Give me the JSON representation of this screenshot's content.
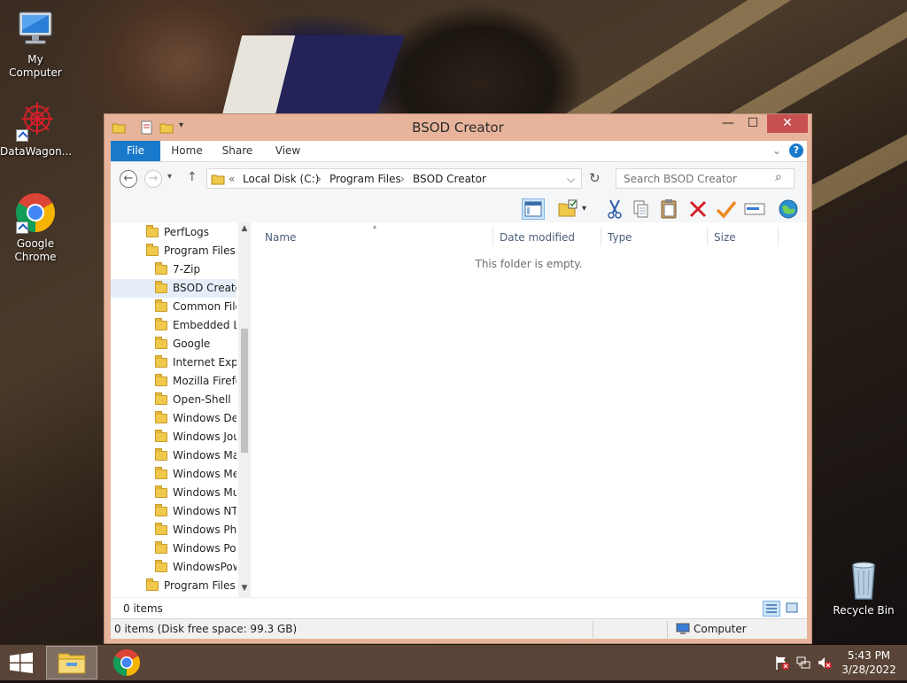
{
  "desktop": {
    "icons": [
      {
        "label": "My Computer"
      },
      {
        "label": "DataWagon..."
      },
      {
        "label": "Google Chrome"
      },
      {
        "label": "Recycle Bin"
      }
    ]
  },
  "window": {
    "title": "BSOD Creator",
    "controls": {
      "minimize": "—",
      "maximize": "☐",
      "close": "✕"
    },
    "ribbon": {
      "tabs": [
        "File",
        "Home",
        "Share",
        "View"
      ],
      "help": "?"
    },
    "nav": {
      "back": "←",
      "forward": "→",
      "recent": "▾",
      "up": "↑",
      "overflow": "«",
      "breadcrumb": [
        "Local Disk (C:)",
        "Program Files",
        "BSOD Creator"
      ],
      "separator": "›",
      "dropdown": "⌵",
      "refresh": "↻",
      "search_placeholder": "Search BSOD Creator",
      "search_icon": "⌕"
    },
    "toolbar_icons": [
      "preview-pane-icon",
      "properties-icon",
      "cut-icon",
      "copy-icon",
      "paste-icon",
      "delete-icon",
      "checkmark-icon",
      "rename-icon",
      "internet-icon"
    ],
    "tree": [
      {
        "label": "PerfLogs",
        "level": 1
      },
      {
        "label": "Program Files",
        "level": 1
      },
      {
        "label": "7-Zip",
        "level": 2
      },
      {
        "label": "BSOD Creato",
        "level": 2,
        "selected": true
      },
      {
        "label": "Common File",
        "level": 2
      },
      {
        "label": "Embedded Lo",
        "level": 2
      },
      {
        "label": "Google",
        "level": 2
      },
      {
        "label": "Internet Explo",
        "level": 2
      },
      {
        "label": "Mozilla Firefo",
        "level": 2
      },
      {
        "label": "Open-Shell",
        "level": 2
      },
      {
        "label": "Windows Def",
        "level": 2
      },
      {
        "label": "Windows Jou",
        "level": 2
      },
      {
        "label": "Windows Ma",
        "level": 2
      },
      {
        "label": "Windows Me",
        "level": 2
      },
      {
        "label": "Windows Mu",
        "level": 2
      },
      {
        "label": "Windows NT",
        "level": 2
      },
      {
        "label": "Windows Pho",
        "level": 2
      },
      {
        "label": "Windows Por",
        "level": 2
      },
      {
        "label": "WindowsPow",
        "level": 2
      },
      {
        "label": "Program Files (",
        "level": 1
      }
    ],
    "columns": [
      "Name",
      "Date modified",
      "Type",
      "Size"
    ],
    "empty_message": "This folder is empty.",
    "item_count": "0 items",
    "status": {
      "left": "0 items (Disk free space: 99.3 GB)",
      "right": "Computer"
    }
  },
  "taskbar": {
    "time": "5:43 PM",
    "date": "3/28/2022"
  },
  "colors": {
    "accent": "#1979ca",
    "titlebar": "#e7b49b",
    "close": "#c75050",
    "taskbar": "#5a4438"
  }
}
